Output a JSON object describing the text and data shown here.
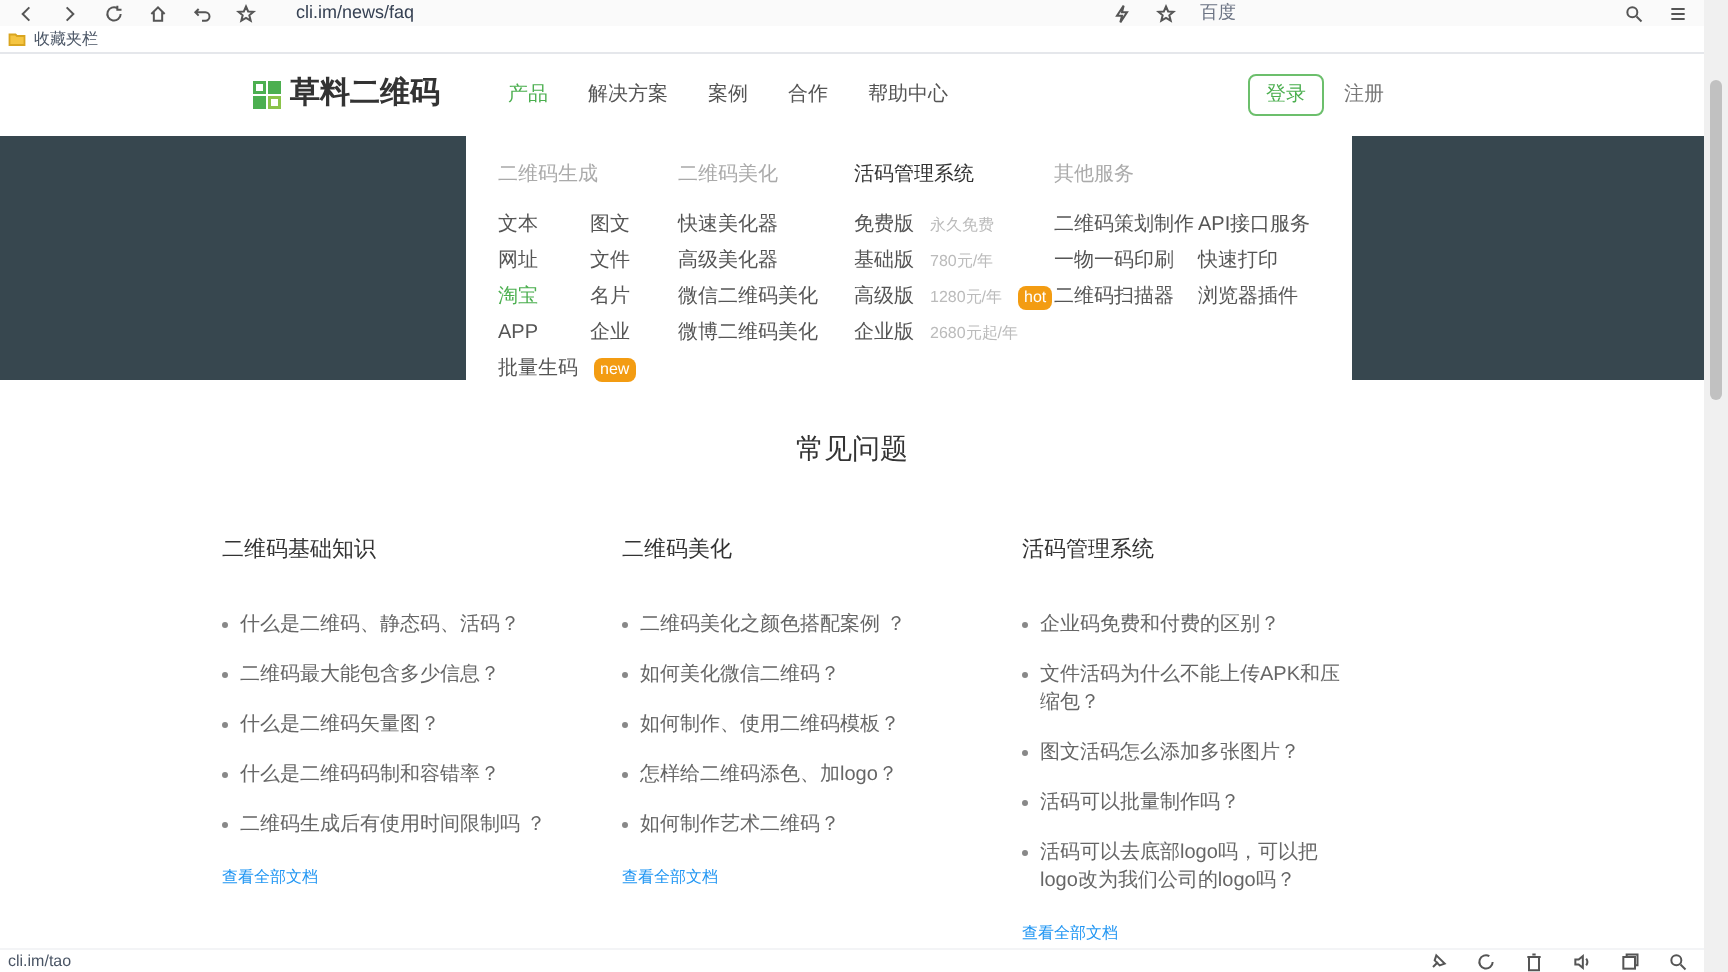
{
  "browser": {
    "url": "cli.im/news/faq",
    "search_engine": "百度",
    "bookmarks_folder": "收藏夹栏"
  },
  "header": {
    "logo": "草料二维码",
    "nav": [
      {
        "label": "产品",
        "selected": true
      },
      {
        "label": "解决方案",
        "selected": false
      },
      {
        "label": "案例",
        "selected": false
      },
      {
        "label": "合作",
        "selected": false
      },
      {
        "label": "帮助中心",
        "selected": false
      }
    ],
    "login": "登录",
    "register": "注册"
  },
  "dropdown": {
    "columns": [
      {
        "heading": "二维码生成",
        "emphasized": false,
        "kind": "grid",
        "items": [
          {
            "label": "文本",
            "highlighted": false
          },
          {
            "label": "图文",
            "highlighted": false
          },
          {
            "label": "网址",
            "highlighted": false
          },
          {
            "label": "文件",
            "highlighted": false
          },
          {
            "label": "淘宝",
            "highlighted": true
          },
          {
            "label": "名片",
            "highlighted": false
          },
          {
            "label": "APP",
            "highlighted": false
          },
          {
            "label": "企业",
            "highlighted": false
          },
          {
            "label": "批量生码",
            "highlighted": false,
            "badge": "new"
          }
        ]
      },
      {
        "heading": "二维码美化",
        "emphasized": false,
        "kind": "list",
        "items": [
          {
            "label": "快速美化器",
            "highlighted": false
          },
          {
            "label": "高级美化器",
            "highlighted": false
          },
          {
            "label": "微信二维码美化",
            "highlighted": false
          },
          {
            "label": "微博二维码美化",
            "highlighted": false
          }
        ]
      },
      {
        "heading": "活码管理系统",
        "emphasized": true,
        "kind": "plans",
        "items": [
          {
            "label": "免费版",
            "price": "永久免费",
            "highlighted": false
          },
          {
            "label": "基础版",
            "price": "780元/年",
            "highlighted": false
          },
          {
            "label": "高级版",
            "price": "1280元/年",
            "badge": "hot",
            "highlighted": false
          },
          {
            "label": "企业版",
            "price": "2680元起/年",
            "highlighted": false
          }
        ]
      },
      {
        "heading": "其他服务",
        "emphasized": false,
        "kind": "grid-wide",
        "items": [
          {
            "label": "二维码策划制作",
            "highlighted": false
          },
          {
            "label": "API接口服务",
            "highlighted": false
          },
          {
            "label": "一物一码印刷",
            "highlighted": false
          },
          {
            "label": "快速打印",
            "highlighted": false
          },
          {
            "label": "二维码扫描器",
            "highlighted": false
          },
          {
            "label": "浏览器插件",
            "highlighted": false
          }
        ]
      }
    ]
  },
  "faq": {
    "title": "常见问题",
    "sections": [
      {
        "heading": "二维码基础知识",
        "questions": [
          "什么是二维码、静态码、活码？",
          "二维码最大能包含多少信息？",
          "什么是二维码矢量图？",
          "什么是二维码码制和容错率？",
          "二维码生成后有使用时间限制吗 ？"
        ],
        "more": "查看全部文档"
      },
      {
        "heading": "二维码美化",
        "questions": [
          "二维码美化之颜色搭配案例 ？",
          "如何美化微信二维码？",
          "如何制作、使用二维码模板？",
          "怎样给二维码添色、加logo？",
          "如何制作艺术二维码？"
        ],
        "more": "查看全部文档"
      },
      {
        "heading": "活码管理系统",
        "questions": [
          "企业码免费和付费的区别？",
          "文件活码为什么不能上传APK和压缩包？",
          "图文活码怎么添加多张图片？",
          "活码可以批量制作吗？",
          "活码可以去底部logo吗，可以把logo改为我们公司的logo吗？"
        ],
        "more": "查看全部文档"
      }
    ]
  },
  "status_bar": {
    "url": "cli.im/tao"
  }
}
